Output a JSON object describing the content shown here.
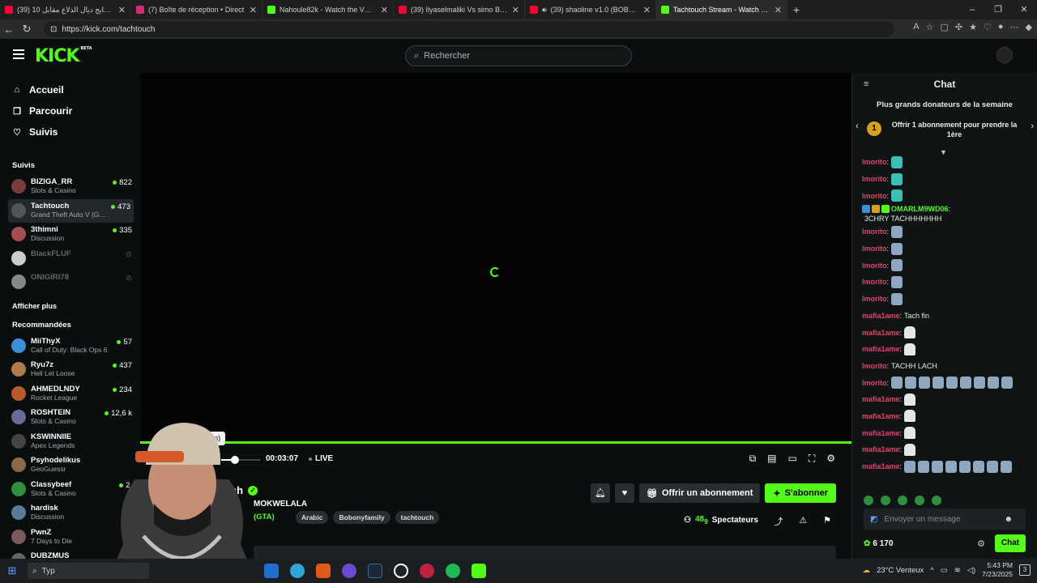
{
  "browser": {
    "tabs": [
      {
        "title": "(39) تحدي طايح ديال الذلاع مقابل 10",
        "fav": "#ff0033",
        "active": false
      },
      {
        "title": "(7) Boîte de réception • Direct",
        "fav": "#d62976",
        "active": false
      },
      {
        "title": "Nahoule82k - Watch the VOD on Kick",
        "fav": "#53fc18",
        "active": false
      },
      {
        "title": "(39) Ilyaselmaliki Vs simo Bourkadi",
        "fav": "#ff0033",
        "active": false
      },
      {
        "title": "(39) shaoline v1.0 (BOBONY FAMILY)",
        "fav": "#ff0033",
        "active": false,
        "audio": true
      },
      {
        "title": "Tachtouch Stream - Watch Live on Kick",
        "fav": "#53fc18",
        "active": true
      }
    ],
    "url": "https://kick.com/tachtouch"
  },
  "header": {
    "logo": "KICK",
    "logo_beta": "BETA",
    "search_placeholder": "Rechercher"
  },
  "sidebar": {
    "nav": [
      {
        "label": "Accueil",
        "icon": "home-icon"
      },
      {
        "label": "Parcourir",
        "icon": "browse-icon"
      },
      {
        "label": "Suivis",
        "icon": "heart-icon"
      }
    ],
    "following_title": "Suivis",
    "following": [
      {
        "name": "BIZIGA_RR",
        "category": "Slots & Casino",
        "viewers": "822",
        "live": true,
        "color": "#7a3b3b"
      },
      {
        "name": "Tachtouch",
        "category": "Grand Theft Auto V (G...",
        "viewers": "473",
        "live": true,
        "color": "#555"
      },
      {
        "name": "3thimni",
        "category": "Discussion",
        "viewers": "335",
        "live": true,
        "color": "#a34f4f"
      },
      {
        "name": "BlackFLUF",
        "category": "",
        "viewers": "",
        "live": false,
        "color": "#ccc"
      },
      {
        "name": "ONIGIRI78",
        "category": "",
        "viewers": "",
        "live": false,
        "color": "#888"
      }
    ],
    "show_more": "Afficher plus",
    "recommended_title": "Recommandées",
    "recommended": [
      {
        "name": "MiiThyX",
        "category": "Call of Duty: Black Ops 6",
        "viewers": "57",
        "color": "#3a8fd6"
      },
      {
        "name": "Ryu7z",
        "category": "Hell Let Loose",
        "viewers": "437",
        "color": "#b07a4a"
      },
      {
        "name": "AHMEDLNDY",
        "category": "Rocket League",
        "viewers": "234",
        "color": "#b85a2a"
      },
      {
        "name": "ROSHTEIN",
        "category": "Slots & Casino",
        "viewers": "12,6 k",
        "color": "#6a6a9a"
      },
      {
        "name": "KSWINNIIE",
        "category": "Apex Legends",
        "viewers": "",
        "color": "#444"
      },
      {
        "name": "Psyhodelikus",
        "category": "GeoGuessr",
        "viewers": "",
        "color": "#8a6a4a"
      },
      {
        "name": "Classybeef",
        "category": "Slots & Casino",
        "viewers": "2,",
        "color": "#2e8f3d"
      },
      {
        "name": "hardisk",
        "category": "Discussion",
        "viewers": "",
        "color": "#5a7a9a"
      },
      {
        "name": "PwnZ",
        "category": "7 Days to Die",
        "viewers": "",
        "color": "#7a5a5a"
      },
      {
        "name": "DUBZMUS",
        "category": "",
        "viewers": "",
        "color": "#666"
      }
    ]
  },
  "player": {
    "progress": 1.0,
    "volume": 0.35,
    "time": "00:03:07",
    "live_label": "LIVE",
    "tooltip": "er le son (m)"
  },
  "stream": {
    "name": "ouch",
    "title": "MOKWELALA",
    "game": "(GTA)",
    "tags": [
      "Arabic",
      "Bobonyfamily",
      "tachtouch"
    ],
    "gift_label": "Offrir un abonnement",
    "subscribe_label": "S'abonner",
    "viewers": "48",
    "viewers_suffix": "9",
    "viewers_label": "Spectateurs"
  },
  "chat": {
    "title": "Chat",
    "donors_title": "Plus grands donateurs de la semaine",
    "donor_rank": "1",
    "donor_offer": "Offrir 1 abonnement pour prendre la 1ère",
    "messages": [
      {
        "user": "Imorito",
        "color": "pink",
        "text": "",
        "emotes": [
          "t"
        ]
      },
      {
        "user": "Imorito",
        "color": "pink",
        "text": "",
        "emotes": [
          "t"
        ]
      },
      {
        "user": "Imorito",
        "color": "pink",
        "text": "",
        "emotes": [
          "t"
        ]
      },
      {
        "user": "OMARLM9WD06",
        "color": "green",
        "text": "3CHRY TACHHHHHHH",
        "emotes": [],
        "badges": true
      },
      {
        "user": "Imorito",
        "color": "pink",
        "text": "",
        "emotes": [
          "g"
        ]
      },
      {
        "user": "Imorito",
        "color": "pink",
        "text": "",
        "emotes": [
          "g"
        ]
      },
      {
        "user": "Imorito",
        "color": "pink",
        "text": "",
        "emotes": [
          "g"
        ]
      },
      {
        "user": "Imorito",
        "color": "pink",
        "text": "",
        "emotes": [
          "g"
        ]
      },
      {
        "user": "Imorito",
        "color": "pink",
        "text": "",
        "emotes": [
          "g"
        ]
      },
      {
        "user": "mafia1ame",
        "color": "pink",
        "text": "Tach fin",
        "emotes": []
      },
      {
        "user": "mafia1ame",
        "color": "pink",
        "text": "",
        "emotes": [
          "w"
        ]
      },
      {
        "user": "mafia1ame",
        "color": "pink",
        "text": "",
        "emotes": [
          "w"
        ]
      },
      {
        "user": "Imorito",
        "color": "pink",
        "text": "TACHH LACH",
        "emotes": []
      },
      {
        "user": "Imorito",
        "color": "pink",
        "text": "",
        "emotes": [
          "g",
          "g",
          "g",
          "g",
          "g",
          "g",
          "g",
          "g",
          "g"
        ]
      },
      {
        "user": "mafia1ame",
        "color": "pink",
        "text": "",
        "emotes": [
          "w"
        ]
      },
      {
        "user": "mafia1ame",
        "color": "pink",
        "text": "",
        "emotes": [
          "w"
        ]
      },
      {
        "user": "mafia1ame",
        "color": "pink",
        "text": "",
        "emotes": [
          "w"
        ]
      },
      {
        "user": "mafia1ame",
        "color": "pink",
        "text": "",
        "emotes": [
          "w"
        ]
      },
      {
        "user": "mafia1ame",
        "color": "pink",
        "text": "",
        "emotes": [
          "g",
          "g",
          "g",
          "g",
          "g",
          "g",
          "g",
          "g"
        ]
      }
    ],
    "input_placeholder": "Envoyer un message",
    "points": "6 170",
    "send_label": "Chat"
  },
  "taskbar": {
    "search_text": "Typ",
    "weather": "23°C Venteux",
    "time": "5:43 PM",
    "date": "7/23/2025",
    "notifications": "3"
  }
}
